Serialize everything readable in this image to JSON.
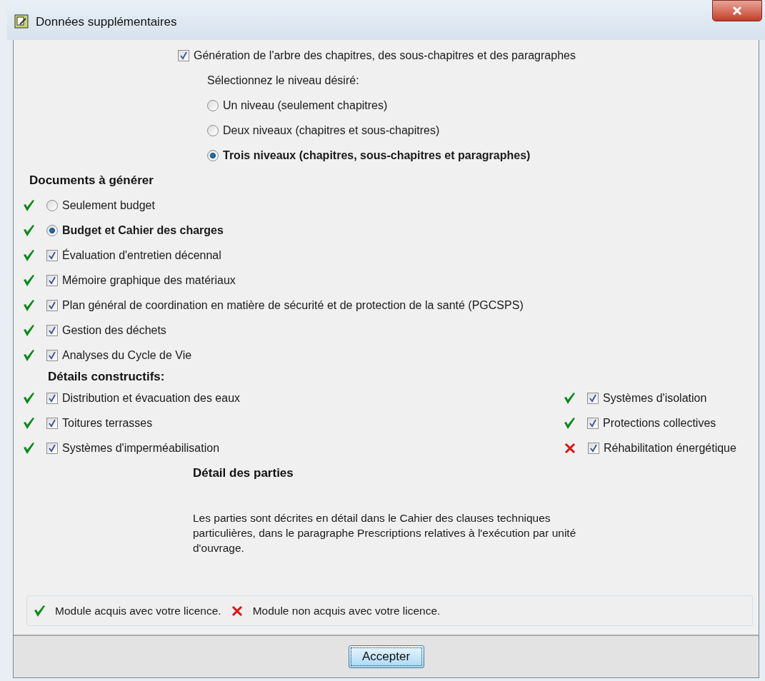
{
  "window": {
    "title": "Données supplémentaires"
  },
  "tree_generation": {
    "label": "Génération de l'arbre des chapitres, des sous-chapitres et des paragraphes",
    "checked": true,
    "prompt": "Sélectionnez le niveau désiré:",
    "levels": [
      {
        "label": "Un niveau (seulement chapitres)",
        "selected": false
      },
      {
        "label": "Deux niveaux (chapitres et sous-chapitres)",
        "selected": false
      },
      {
        "label": "Trois niveaux (chapitres, sous-chapitres et paragraphes)",
        "selected": true
      }
    ]
  },
  "documents": {
    "heading": "Documents à générer",
    "items": [
      {
        "kind": "radio",
        "label": "Seulement budget",
        "selected": false,
        "licensed": true
      },
      {
        "kind": "radio",
        "label": "Budget et Cahier des charges",
        "selected": true,
        "licensed": true
      },
      {
        "kind": "checkbox",
        "label": "Évaluation d'entretien décennal",
        "checked": true,
        "licensed": true
      },
      {
        "kind": "checkbox",
        "label": "Mémoire graphique des matériaux",
        "checked": true,
        "licensed": true
      },
      {
        "kind": "checkbox",
        "label": "Plan général de coordination en matière de sécurité et de protection de la santé (PGCSPS)",
        "checked": true,
        "licensed": true
      },
      {
        "kind": "checkbox",
        "label": "Gestion des déchets",
        "checked": true,
        "licensed": true
      },
      {
        "kind": "checkbox",
        "label": "Analyses du Cycle de Vie",
        "checked": true,
        "licensed": true
      }
    ]
  },
  "construction_details": {
    "heading": "Détails constructifs:",
    "left": [
      {
        "label": "Distribution et évacuation des eaux",
        "checked": true,
        "licensed": true
      },
      {
        "label": "Toitures terrasses",
        "checked": true,
        "licensed": true
      },
      {
        "label": "Systèmes d'imperméabilisation",
        "checked": true,
        "licensed": true
      }
    ],
    "right": [
      {
        "label": "Systèmes d'isolation",
        "checked": true,
        "licensed": true
      },
      {
        "label": "Protections collectives",
        "checked": true,
        "licensed": true
      },
      {
        "label": "Réhabilitation énergétique",
        "checked": true,
        "licensed": false
      }
    ]
  },
  "parts": {
    "heading": "Détail des parties",
    "description": "Les parties sont décrites en détail dans le Cahier des clauses techniques particulières, dans le paragraphe Prescriptions relatives à l'exécution par unité d'ouvrage."
  },
  "legend": [
    {
      "licensed": true,
      "text": "Module acquis avec votre licence."
    },
    {
      "licensed": false,
      "text": "Module non acquis avec votre licence."
    }
  ],
  "buttons": [
    "Accepter"
  ]
}
